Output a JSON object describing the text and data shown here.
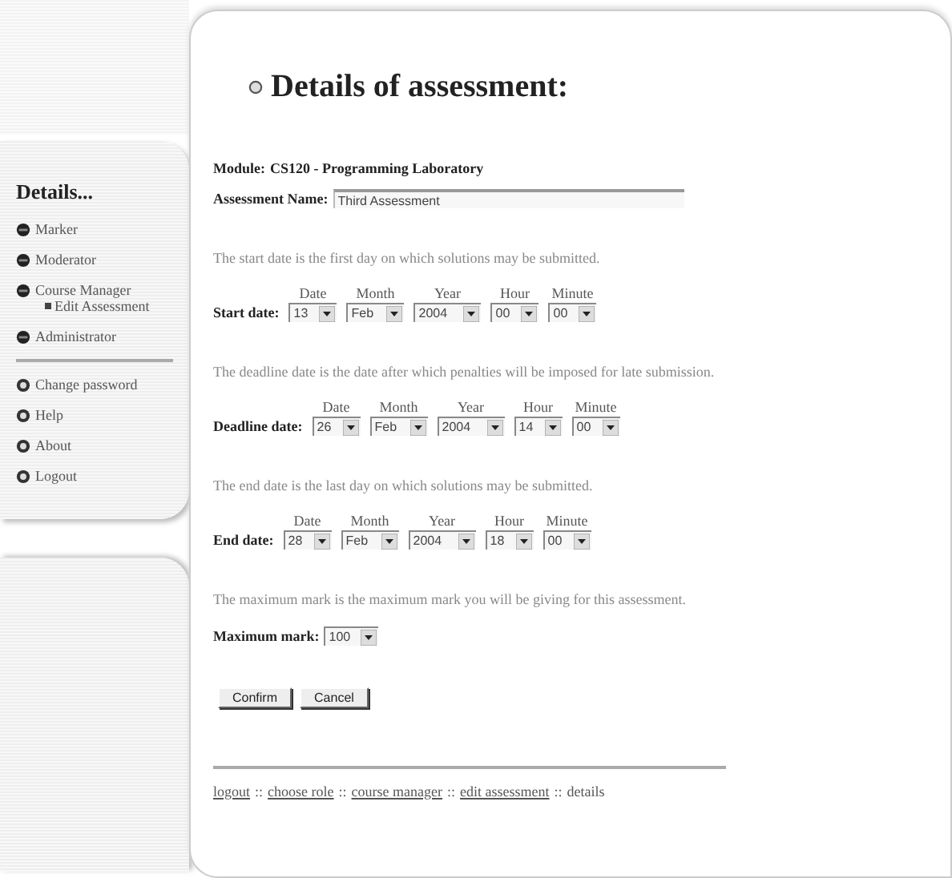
{
  "sidebar": {
    "title": "Details...",
    "items": [
      {
        "label": "Marker",
        "kind": "role"
      },
      {
        "label": "Moderator",
        "kind": "role"
      },
      {
        "label": "Course Manager",
        "kind": "role",
        "children": [
          {
            "label": "Edit Assessment"
          }
        ]
      },
      {
        "label": "Administrator",
        "kind": "role"
      }
    ],
    "account_items": [
      {
        "label": "Change password"
      },
      {
        "label": "Help"
      },
      {
        "label": "About"
      },
      {
        "label": "Logout"
      }
    ]
  },
  "heading": "Details of assessment:",
  "module": {
    "label": "Module:",
    "value": "CS120 - Programming Laboratory"
  },
  "assessment_name": {
    "label": "Assessment Name:",
    "value": "Third Assessment"
  },
  "date_sections": [
    {
      "description": "The start date is the first day on which solutions may be submitted.",
      "label": "Start date:",
      "columns": [
        "Date",
        "Month",
        "Year",
        "Hour",
        "Minute"
      ],
      "values": [
        "13",
        "Feb",
        "2004",
        "00",
        "00"
      ]
    },
    {
      "description": "The deadline date is the date after which penalties will be imposed for late submission.",
      "label": "Deadline date:",
      "columns": [
        "Date",
        "Month",
        "Year",
        "Hour",
        "Minute"
      ],
      "values": [
        "26",
        "Feb",
        "2004",
        "14",
        "00"
      ]
    },
    {
      "description": "The end date is the last day on which solutions may be submitted.",
      "label": "End date:",
      "columns": [
        "Date",
        "Month",
        "Year",
        "Hour",
        "Minute"
      ],
      "values": [
        "28",
        "Feb",
        "2004",
        "18",
        "00"
      ]
    }
  ],
  "maximum_mark": {
    "description": "The maximum mark is the maximum mark you will be giving for this assessment.",
    "label": "Maximum mark:",
    "value": "100"
  },
  "buttons": [
    "Confirm",
    "Cancel"
  ],
  "breadcrumb": {
    "separator": "::",
    "items": [
      {
        "label": "logout",
        "link": true
      },
      {
        "label": "choose role",
        "link": true
      },
      {
        "label": "course manager",
        "link": true
      },
      {
        "label": "edit assessment",
        "link": true
      },
      {
        "label": "details",
        "link": false
      }
    ]
  }
}
